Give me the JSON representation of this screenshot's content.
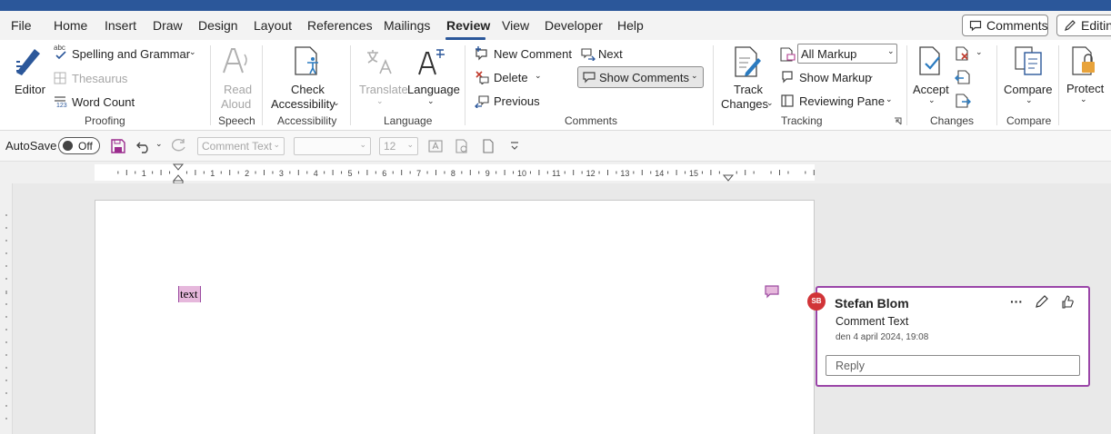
{
  "menu": {
    "tabs": [
      "File",
      "Home",
      "Insert",
      "Draw",
      "Design",
      "Layout",
      "References",
      "Mailings",
      "Review",
      "View",
      "Developer",
      "Help"
    ],
    "comments_button": "Comments",
    "editing_button": "Editing"
  },
  "ribbon": {
    "proofing": {
      "editor": "Editor",
      "spelling": "Spelling and Grammar",
      "thesaurus": "Thesaurus",
      "word_count": "Word Count",
      "label": "Proofing",
      "abc": "abc",
      "num": "123"
    },
    "speech": {
      "read_aloud_1": "Read",
      "read_aloud_2": "Aloud",
      "label": "Speech"
    },
    "accessibility": {
      "check_1": "Check",
      "check_2": "Accessibility",
      "label": "Accessibility"
    },
    "language": {
      "translate": "Translate",
      "language": "Language",
      "label": "Language"
    },
    "comments": {
      "new_comment": "New Comment",
      "delete": "Delete",
      "previous": "Previous",
      "next": "Next",
      "show_comments": "Show Comments",
      "label": "Comments"
    },
    "tracking": {
      "track_1": "Track",
      "track_2": "Changes",
      "markup_select": "All Markup",
      "show_markup": "Show Markup",
      "reviewing_pane": "Reviewing Pane",
      "label": "Tracking"
    },
    "changes": {
      "accept": "Accept",
      "label": "Changes"
    },
    "compare": {
      "compare": "Compare",
      "label": "Compare"
    },
    "protect": {
      "protect": "Protect"
    }
  },
  "qat": {
    "autosave": "AutoSave",
    "autosave_state": "Off",
    "style_select": "Comment Text",
    "font_size": "12"
  },
  "ruler": {
    "numbers": [
      "1",
      "2",
      "3",
      "4",
      "5",
      "6",
      "7",
      "8",
      "9",
      "10",
      "11",
      "12",
      "13",
      "14",
      "15"
    ]
  },
  "document": {
    "text": "text"
  },
  "comment": {
    "initials": "SB",
    "author": "Stefan Blom",
    "body": "Comment Text",
    "date": "den 4 april 2024, 19:08",
    "reply_placeholder": "Reply",
    "more": "···"
  },
  "colors": {
    "accent": "#2b579a",
    "comment_border": "#9a45a8",
    "avatar": "#d13438",
    "highlight": "#e6b8dc"
  }
}
